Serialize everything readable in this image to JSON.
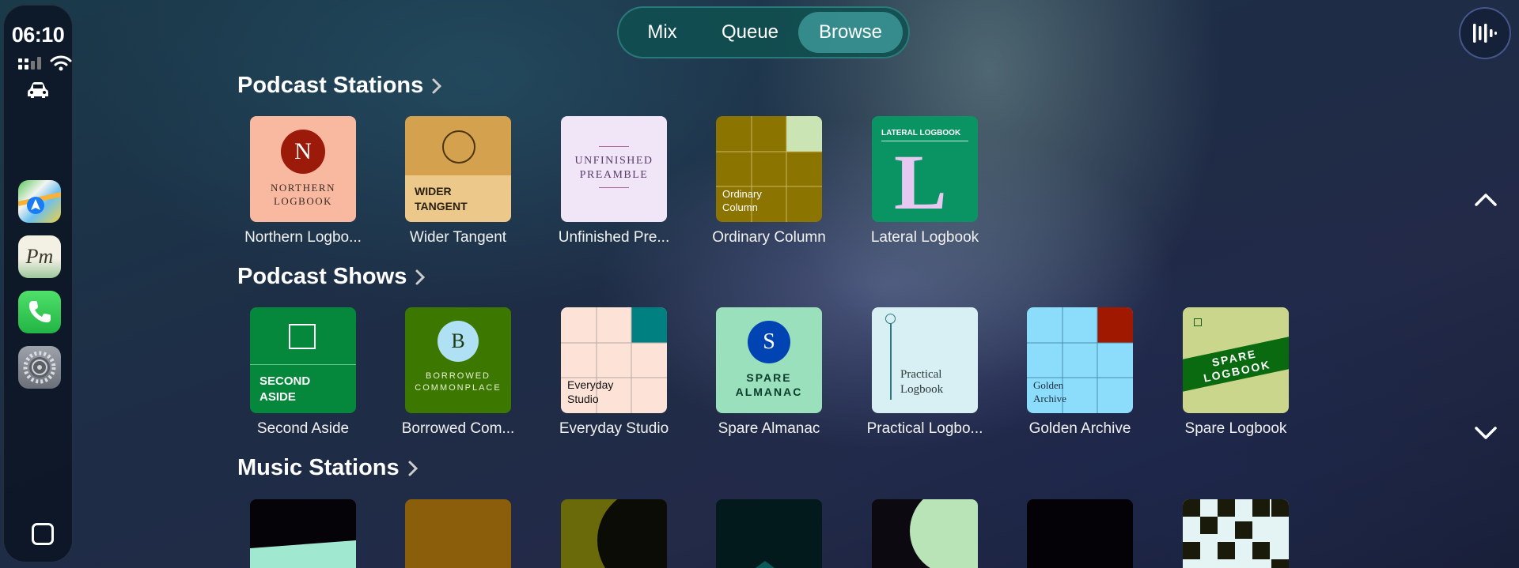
{
  "status": {
    "time": "06:10"
  },
  "tabs": [
    {
      "label": "Mix",
      "active": false
    },
    {
      "label": "Queue",
      "active": false
    },
    {
      "label": "Browse",
      "active": true
    }
  ],
  "sections": [
    {
      "title": "Podcast Stations",
      "items": [
        {
          "caption": "Northern Logbo...",
          "art_text": [
            "N",
            "NORTHERN",
            "LOGBOOK"
          ]
        },
        {
          "caption": "Wider Tangent",
          "art_text": [
            "WIDER",
            "TANGENT"
          ]
        },
        {
          "caption": "Unfinished Pre...",
          "art_text": [
            "UNFINISHED",
            "PREAMBLE"
          ]
        },
        {
          "caption": "Ordinary Column",
          "art_text": [
            "Ordinary",
            "Column"
          ]
        },
        {
          "caption": "Lateral Logbook",
          "art_text": [
            "LATERAL LOGBOOK",
            "L"
          ]
        }
      ]
    },
    {
      "title": "Podcast Shows",
      "items": [
        {
          "caption": "Second Aside",
          "art_text": [
            "SECOND",
            "ASIDE"
          ]
        },
        {
          "caption": "Borrowed Com...",
          "art_text": [
            "B",
            "BORROWED",
            "COMMONPLACE"
          ]
        },
        {
          "caption": "Everyday Studio",
          "art_text": [
            "Everyday",
            "Studio"
          ]
        },
        {
          "caption": "Spare Almanac",
          "art_text": [
            "S",
            "SPARE",
            "ALMANAC"
          ]
        },
        {
          "caption": "Practical Logbo...",
          "art_text": [
            "Practical",
            "Logbook"
          ]
        },
        {
          "caption": "Golden Archive",
          "art_text": [
            "Golden",
            "Archive"
          ]
        },
        {
          "caption": "Spare Logbook",
          "art_text": [
            "SPARE",
            "LOGBOOK"
          ]
        }
      ]
    },
    {
      "title": "Music Stations",
      "items": []
    }
  ],
  "apps": [
    "maps-icon",
    "pm-app-icon",
    "phone-icon",
    "settings-icon"
  ],
  "pm_app_text": "Pm",
  "colors": {
    "segment_bg": "#0f5050",
    "segment_active": "#3c9696"
  }
}
